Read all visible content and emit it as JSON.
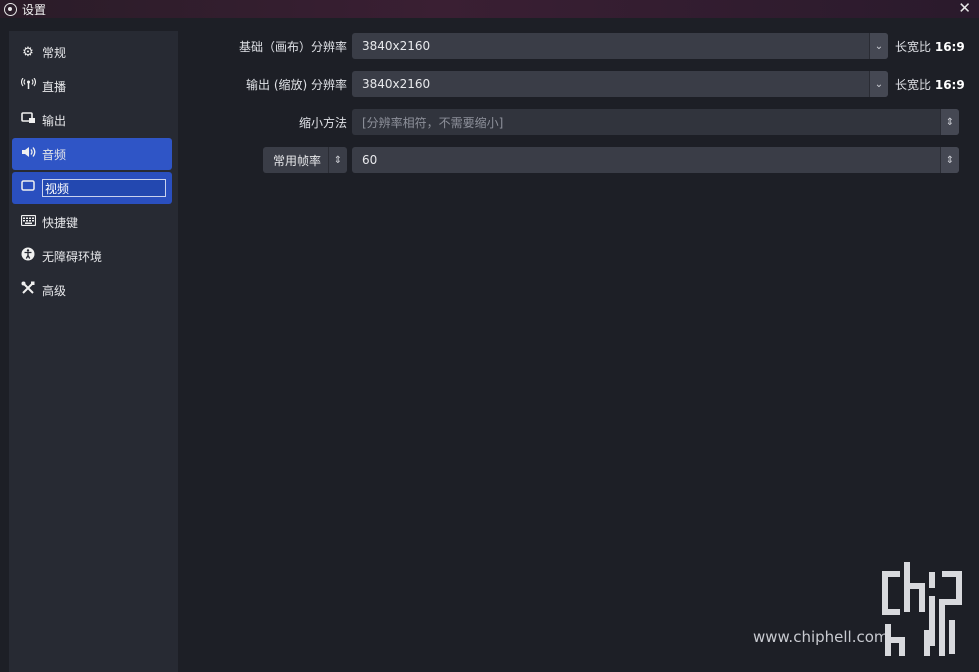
{
  "window": {
    "title": "设置"
  },
  "sidebar": {
    "items": [
      {
        "label": "常规",
        "icon": "gear-icon"
      },
      {
        "label": "直播",
        "icon": "antenna-icon"
      },
      {
        "label": "输出",
        "icon": "output-icon"
      },
      {
        "label": "音频",
        "icon": "speaker-icon"
      },
      {
        "label": "视频",
        "icon": "monitor-icon"
      },
      {
        "label": "快捷键",
        "icon": "keyboard-icon"
      },
      {
        "label": "无障碍环境",
        "icon": "accessibility-icon"
      },
      {
        "label": "高级",
        "icon": "tools-icon"
      }
    ]
  },
  "video": {
    "base_resolution": {
      "label": "基础（画布）分辨率",
      "value": "3840x2160",
      "aspect_label": "长宽比",
      "aspect_value": "16:9"
    },
    "output_resolution": {
      "label": "输出 (缩放) 分辨率",
      "value": "3840x2160",
      "aspect_label": "长宽比",
      "aspect_value": "16:9"
    },
    "downscale_filter": {
      "label": "缩小方法",
      "value": "[分辨率相符，不需要缩小]"
    },
    "fps": {
      "type_label": "常用帧率",
      "value": "60"
    }
  },
  "watermark": {
    "url": "www.chiphell.com"
  }
}
